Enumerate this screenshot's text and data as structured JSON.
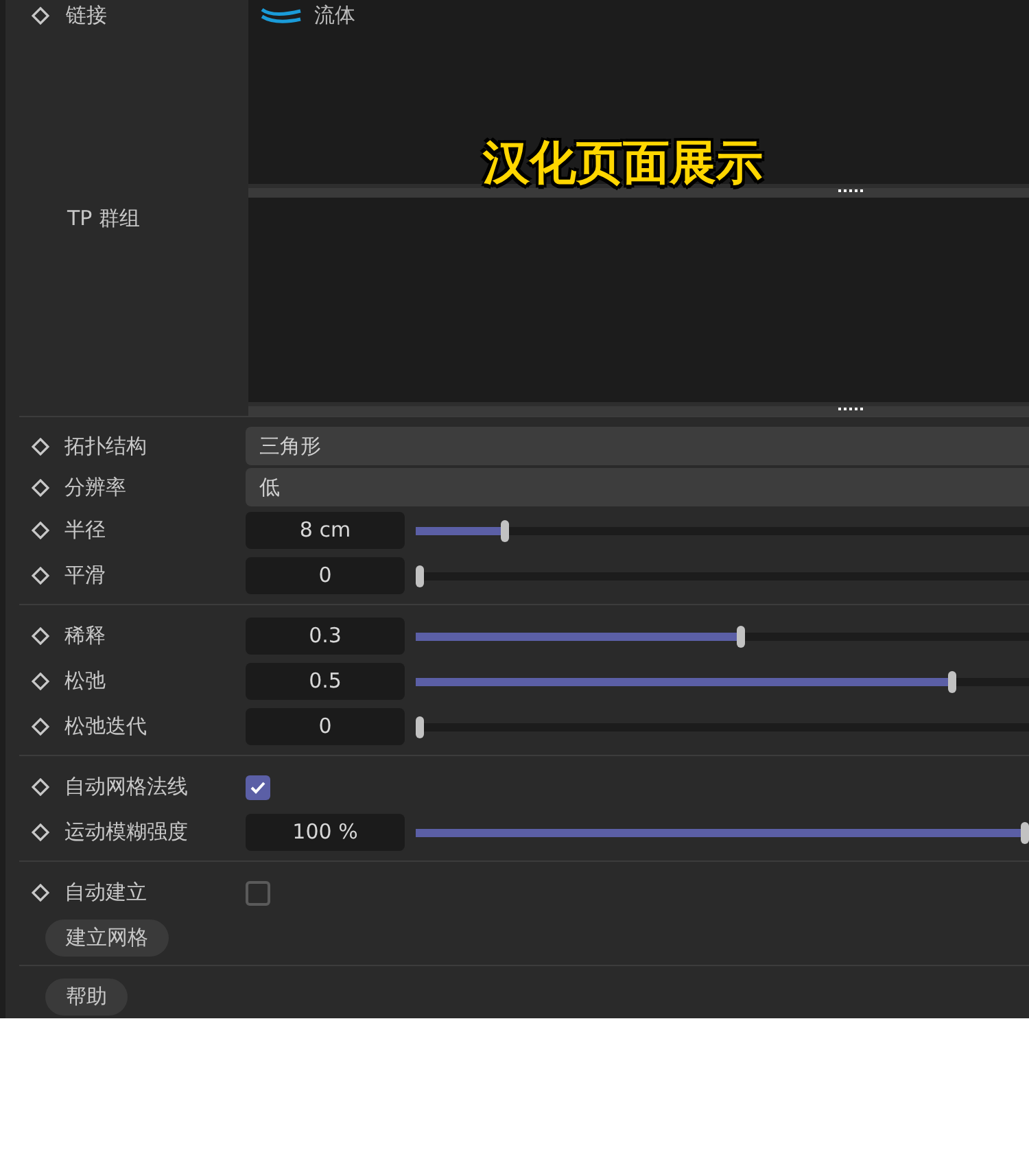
{
  "link_row": {
    "label": "链接",
    "items": [
      {
        "label": "流体"
      }
    ]
  },
  "tp_group": {
    "label": "TP 群组"
  },
  "caption": "汉化页面展示",
  "groups": [
    [
      {
        "kind": "dropdown",
        "label": "拓扑结构",
        "value": "三角形"
      },
      {
        "kind": "dropdown",
        "label": "分辨率",
        "value": "低"
      },
      {
        "kind": "slider",
        "label": "半径",
        "value": "8 cm",
        "level": 0.14
      },
      {
        "kind": "slider",
        "label": "平滑",
        "value": "0",
        "level": 0
      }
    ],
    [
      {
        "kind": "slider",
        "label": "稀释",
        "value": "0.3",
        "level": 0.53
      },
      {
        "kind": "slider",
        "label": "松弛",
        "value": "0.5",
        "level": 0.88
      },
      {
        "kind": "slider",
        "label": "松弛迭代",
        "value": "0",
        "level": 0
      }
    ],
    [
      {
        "kind": "checkbox",
        "label": "自动网格法线",
        "checked": true
      },
      {
        "kind": "slider",
        "label": "运动模糊强度",
        "value": "100 %",
        "level": 1
      }
    ],
    [
      {
        "kind": "checkbox",
        "label": "自动建立",
        "checked": false
      },
      {
        "kind": "button",
        "label": "建立网格"
      }
    ],
    [
      {
        "kind": "button",
        "label": "帮助"
      }
    ]
  ]
}
